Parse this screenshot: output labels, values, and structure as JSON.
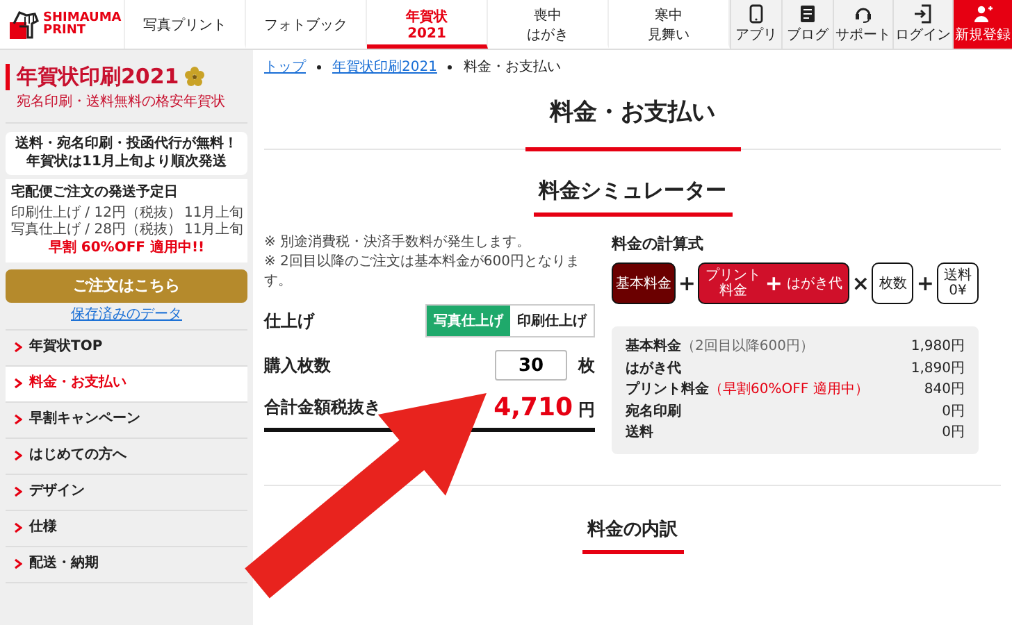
{
  "header": {
    "logo": {
      "line1": "SHIMAUMA",
      "line2": "PRINT"
    },
    "tabs": [
      {
        "lines": [
          "写真プリント"
        ],
        "selected": false
      },
      {
        "lines": [
          "フォトブック"
        ],
        "selected": false
      },
      {
        "lines": [
          "年賀状",
          "2021"
        ],
        "selected": true
      },
      {
        "lines": [
          "喪中",
          "はがき"
        ],
        "selected": false
      },
      {
        "lines": [
          "寒中",
          "見舞い"
        ],
        "selected": false
      }
    ],
    "icon_buttons": [
      {
        "kind": "phone",
        "label": "アプリ"
      },
      {
        "kind": "blog",
        "label": "ブログ"
      },
      {
        "kind": "support",
        "label": "サポート"
      },
      {
        "kind": "login",
        "label": "ログイン"
      },
      {
        "kind": "signup",
        "label": "新規登録"
      }
    ]
  },
  "sidebar": {
    "title": "年賀状印刷2021",
    "subtitle": "宛名印刷・送料無料の格安年賀状",
    "bubble": [
      "送料・宛名印刷・投函代行が無料！",
      "年賀状は11月上旬より順次発送"
    ],
    "shipping": {
      "title": "宅配便ご注文の発送予定日",
      "rows": [
        {
          "label": "印刷仕上げ / 12円（税抜）",
          "value": "11月上旬"
        },
        {
          "label": "写真仕上げ / 28円（税抜）",
          "value": "11月上旬"
        }
      ],
      "note": "早割 60%OFF 適用中!!"
    },
    "order_button": "ご注文はこちら",
    "saved_link": "保存済みのデータ",
    "nav": [
      {
        "label": "年賀状TOP",
        "selected": false
      },
      {
        "label": "料金・お支払い",
        "selected": true
      },
      {
        "label": "早割キャンペーン",
        "selected": false
      },
      {
        "label": "はじめての方へ",
        "selected": false
      },
      {
        "label": "デザイン",
        "selected": false
      },
      {
        "label": "仕様",
        "selected": false
      },
      {
        "label": "配送・納期",
        "selected": false
      }
    ]
  },
  "main": {
    "breadcrumb": [
      {
        "kind": "link",
        "label": "トップ"
      },
      {
        "kind": "link",
        "label": "年賀状印刷2021"
      },
      {
        "kind": "current",
        "label": "料金・お支払い"
      }
    ],
    "page_title": "料金・お支払い",
    "section_title": "料金シミュレーター",
    "notes": [
      "※ 別途消費税・決済手数料が発生します。",
      "※ 2回目以降のご注文は基本料金が600円となります。"
    ],
    "finish": {
      "label": "仕上げ",
      "options": [
        {
          "label": "写真仕上げ",
          "selected": true
        },
        {
          "label": "印刷仕上げ",
          "selected": false
        }
      ]
    },
    "quantity": {
      "label": "購入枚数",
      "value": "30",
      "unit": "枚"
    },
    "total": {
      "label": "合計金額税抜き",
      "amount": "4,710",
      "unit": "円"
    },
    "formula": {
      "title": "料金の計算式",
      "items": [
        {
          "kind": "dark",
          "lines": [
            "基本料金"
          ]
        },
        {
          "kind": "op",
          "text": "+"
        },
        {
          "kind": "red",
          "left": [
            "プリント",
            "料金"
          ],
          "op": "+",
          "right": [
            "はがき代"
          ]
        },
        {
          "kind": "op",
          "text": "×"
        },
        {
          "kind": "outline",
          "lines": [
            "枚数"
          ]
        },
        {
          "kind": "op",
          "text": "+"
        },
        {
          "kind": "outline",
          "lines": [
            "送料",
            "0¥"
          ]
        }
      ]
    },
    "breakdown": [
      {
        "label": "基本料金",
        "note": "（2回目以降600円）",
        "kind": "muted",
        "value": "1,980円"
      },
      {
        "label": "はがき代",
        "value": "1,890円"
      },
      {
        "label": "プリント料金",
        "note": "（早割60%OFF 適用中）",
        "kind": "alert",
        "value": "840円"
      },
      {
        "label": "宛名印刷",
        "value": "0円"
      },
      {
        "label": "送料",
        "value": "0円"
      }
    ],
    "next_section": "料金の内訳"
  }
}
